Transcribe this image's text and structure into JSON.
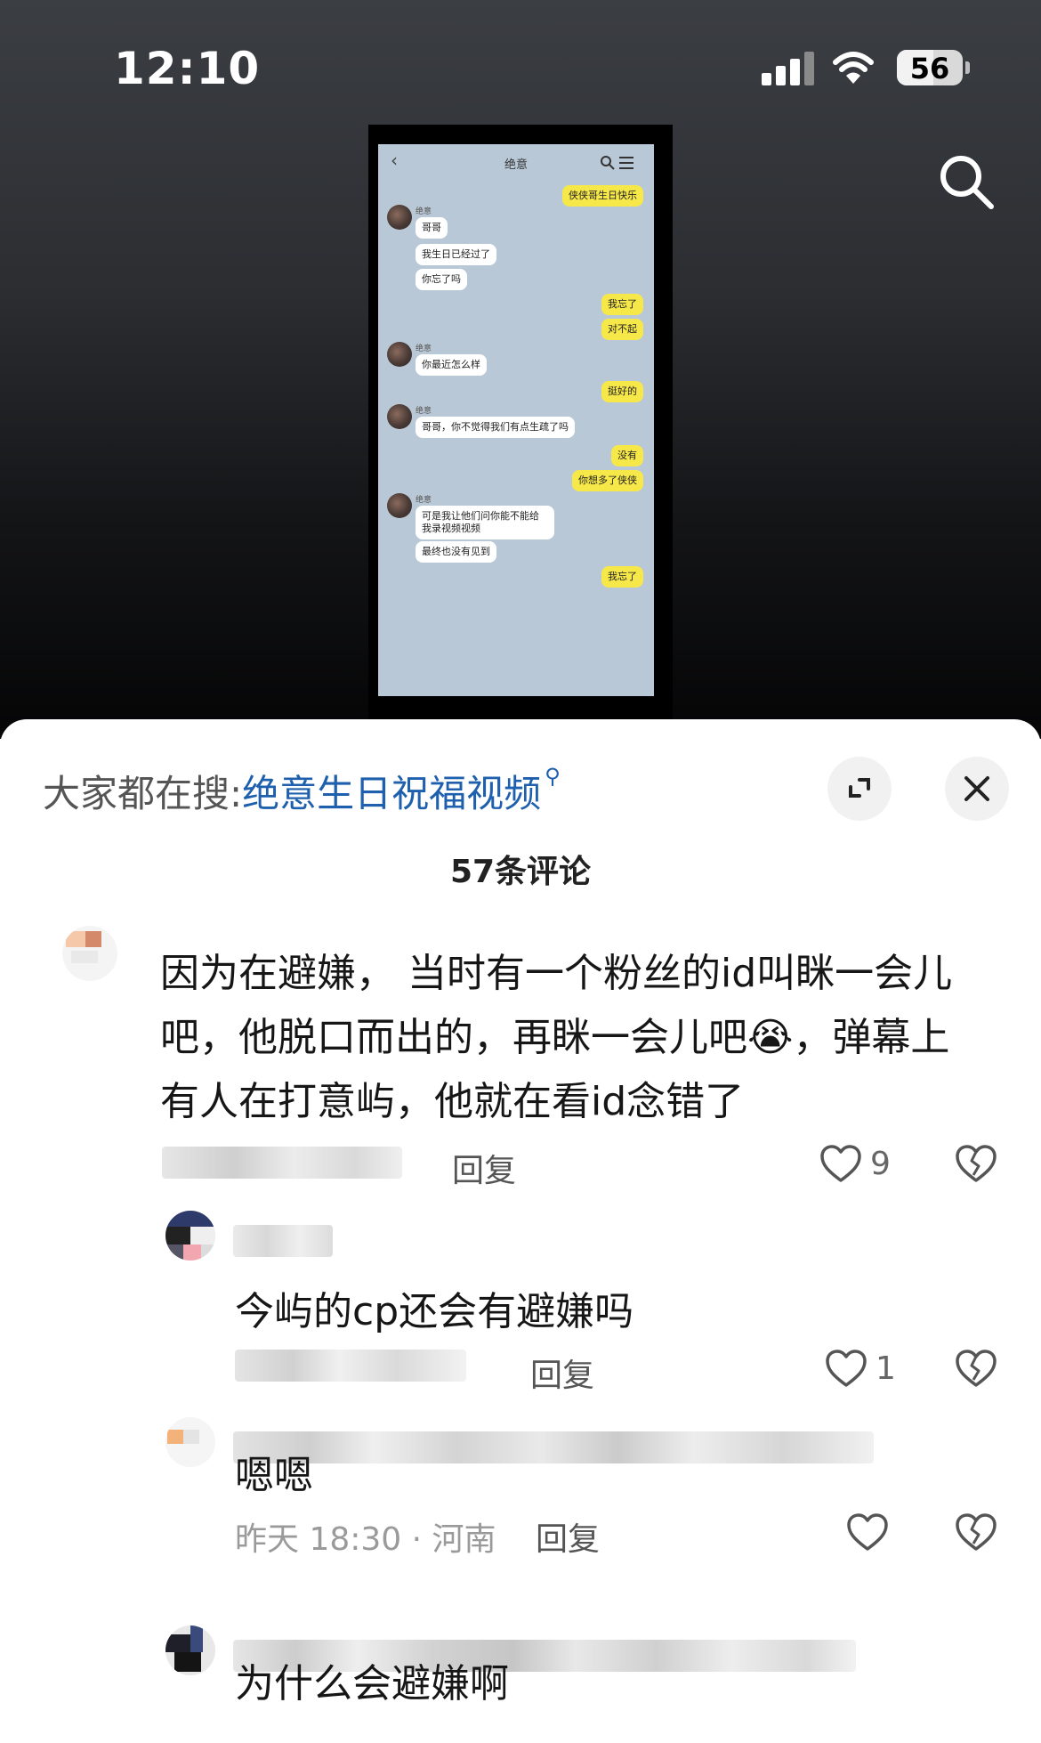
{
  "status_bar": {
    "time": "12:10",
    "battery": "56",
    "battery_level_percent": 56
  },
  "chat_screenshot": {
    "title": "绝意",
    "messages": [
      {
        "dir": "out",
        "text": "侠侠哥生日快乐"
      },
      {
        "dir": "in",
        "sender": "绝意",
        "text": "哥哥"
      },
      {
        "dir": "in",
        "text": "我生日已经过了"
      },
      {
        "dir": "in",
        "text": "你忘了吗"
      },
      {
        "dir": "out",
        "text": "我忘了"
      },
      {
        "dir": "out",
        "text": "对不起"
      },
      {
        "dir": "in",
        "sender": "绝意",
        "text": "你最近怎么样"
      },
      {
        "dir": "out",
        "text": "挺好的"
      },
      {
        "dir": "in",
        "sender": "绝意",
        "text": "哥哥，你不觉得我们有点生疏了吗"
      },
      {
        "dir": "out",
        "text": "没有"
      },
      {
        "dir": "out",
        "text": "你想多了侠侠"
      },
      {
        "dir": "in",
        "sender": "绝意",
        "text": "可是我让他们问你能不能给我录视频视频"
      },
      {
        "dir": "in",
        "text": "最终也没有见到"
      },
      {
        "dir": "out",
        "text": "我忘了"
      }
    ]
  },
  "sheet": {
    "search_prefix": "大家都在搜:",
    "search_term": "绝意生日祝福视频",
    "comment_count": "57条评论"
  },
  "comments": [
    {
      "text": "因为在避嫌， 当时有一个粉丝的id叫眯一会儿吧，他脱口而出的，再眯一会儿吧😭，弹幕上有人在打意屿，他就在看id念错了",
      "reply": "回复",
      "likes": "9"
    },
    {
      "text": "今屿的cp还会有避嫌吗",
      "reply": "回复",
      "likes": "1"
    },
    {
      "text": "嗯嗯",
      "meta": "昨天 18:30 · 河南",
      "reply": "回复",
      "likes": ""
    },
    {
      "text": "为什么会避嫌啊"
    }
  ],
  "colors": {
    "accent": "#1e5fae",
    "bubble_out": "#f7e84a",
    "chat_bg": "#b9c8d6"
  }
}
